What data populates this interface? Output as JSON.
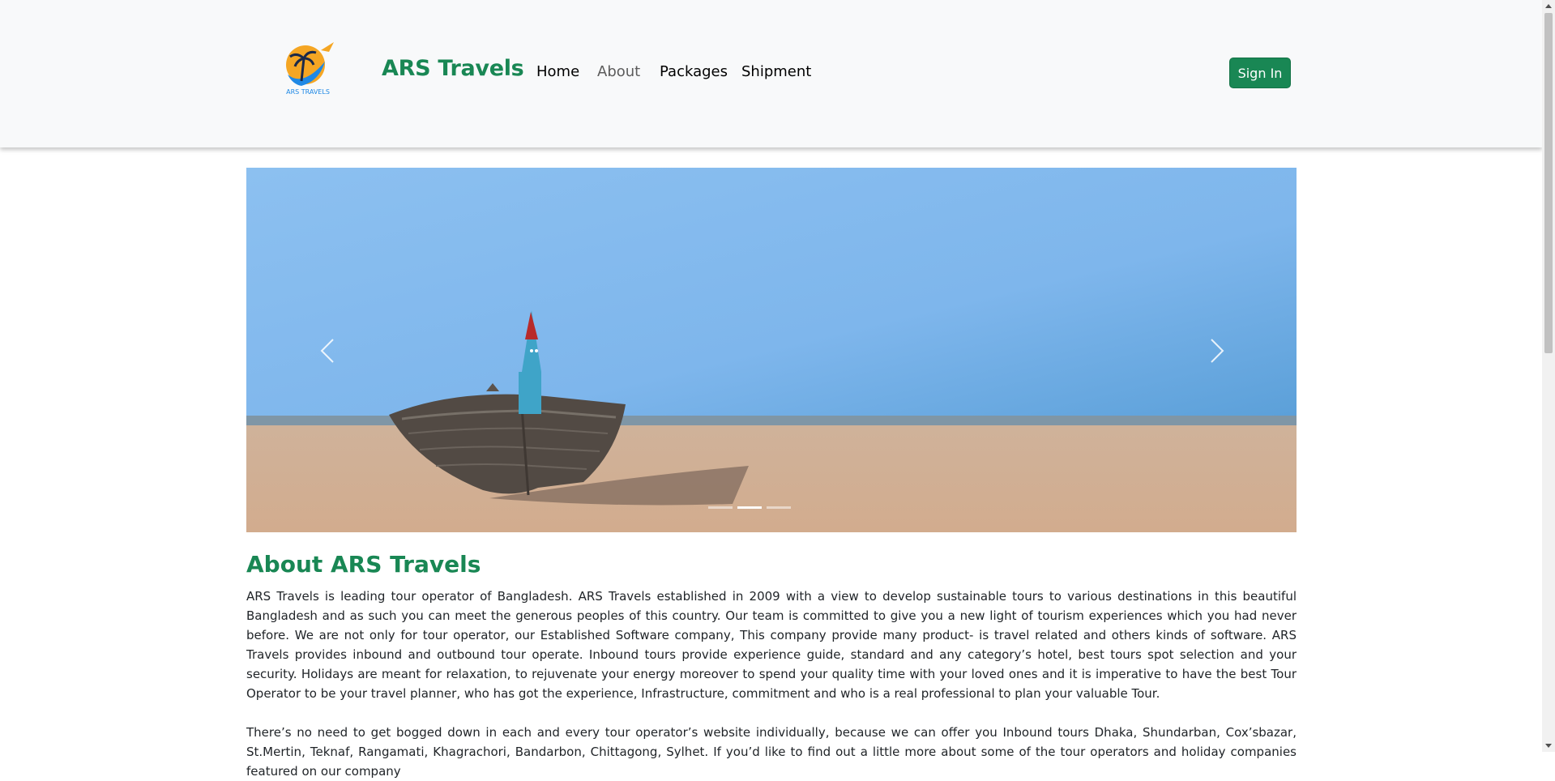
{
  "brand": {
    "logo_text": "ARS TRAVELS",
    "name": "ARS Travels"
  },
  "nav": {
    "items": [
      {
        "label": "Home"
      },
      {
        "label": "About"
      },
      {
        "label": "Packages"
      },
      {
        "label": "Shipment"
      }
    ],
    "active": "About"
  },
  "signin_label": "Sign In",
  "carousel": {
    "slide_image": "beach-boat-image",
    "slides_count": 3,
    "active_slide": 2
  },
  "about": {
    "title": "About ARS Travels",
    "paragraph1": "ARS Travels is leading tour operator of Bangladesh. ARS Travels established in 2009 with a view to develop sustainable tours to various destinations in this beautiful Bangladesh and as such you can meet the generous peoples of this country. Our team is committed to give you a new light of tourism experiences which you had never before. We are not only for tour operator, our Established Software company, This company provide many product- is travel related and others kinds of software. ARS Travels provides inbound and outbound tour operate. Inbound tours provide experience guide, standard and any category’s hotel, best tours spot selection and your security. Holidays are meant for relaxation, to rejuvenate your energy moreover to spend your quality time with your loved ones and it is imperative to have the best Tour Operator to be your travel planner, who has got the experience, Infrastructure, commitment and who is a real professional to plan your valuable Tour.",
    "paragraph2": "There’s no need to get bogged down in each and every tour operator’s website individually, because we can offer you Inbound tours Dhaka, Shundarban, Cox’sbazar, St.Mertin, Teknaf, Rangamati, Khagrachori, Bandarbon, Chittagong, Sylhet. If you’d like to find out a little more about some of the tour operators and holiday companies featured on our company"
  },
  "colors": {
    "brand_green": "#198754",
    "navbar_bg": "#f8f9fa"
  }
}
